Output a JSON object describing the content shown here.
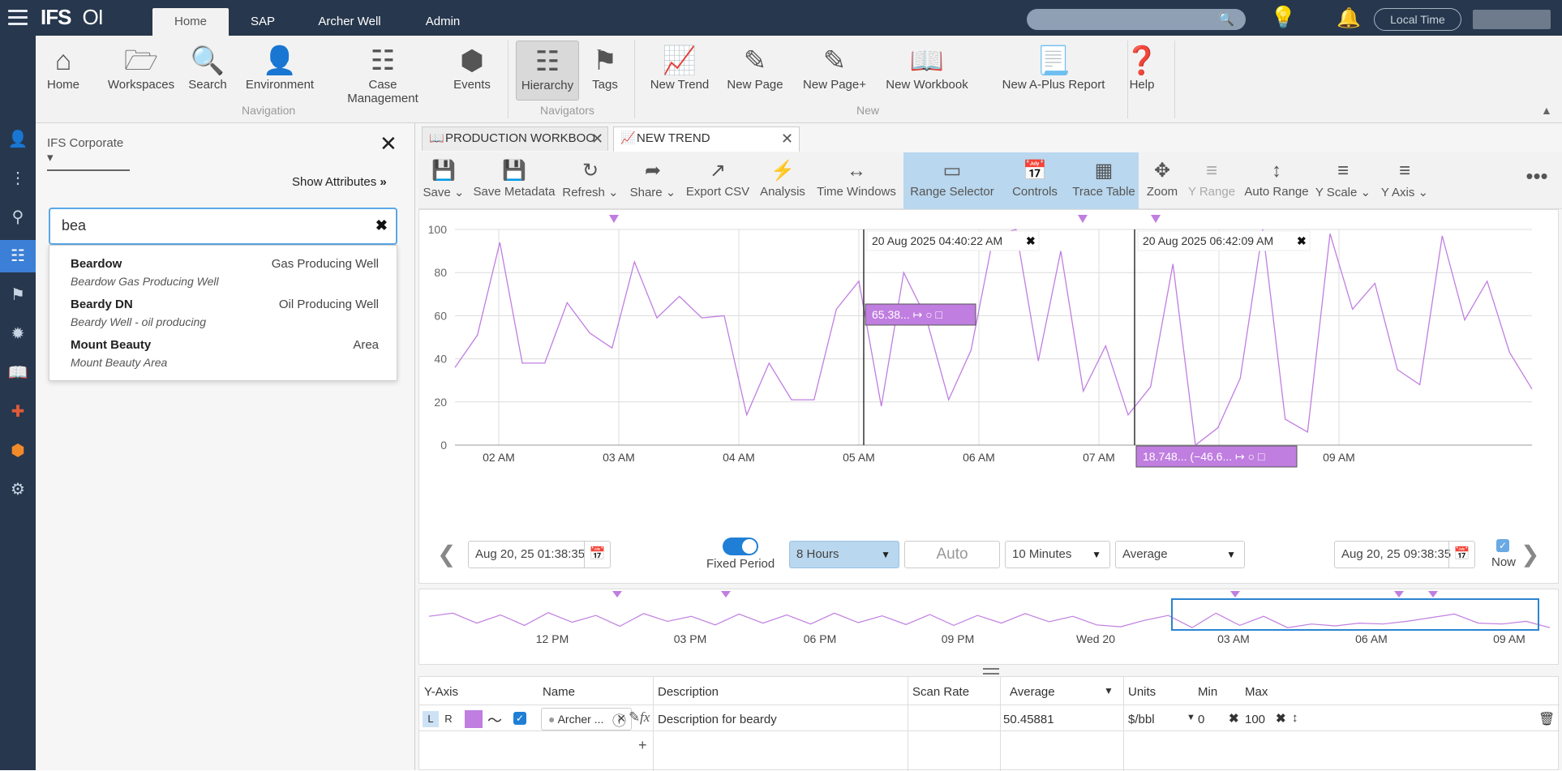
{
  "topbar": {
    "logo": "IFS",
    "product": "OI",
    "tabs": [
      "Home",
      "SAP",
      "Archer Well",
      "Admin"
    ],
    "active_tab": "Home",
    "local_time": "Local Time"
  },
  "ribbon": {
    "navigation": [
      "Home",
      "Workspaces",
      "Search",
      "Environment",
      "Case Management",
      "Events"
    ],
    "navigation_group": "Navigation",
    "navigators": [
      "Hierarchy",
      "Tags"
    ],
    "navigators_group": "Navigators",
    "new_items": [
      "New Trend",
      "New Page",
      "New Page+",
      "New Workbook",
      "New A-Plus Report"
    ],
    "new_group": "New",
    "help": "Help"
  },
  "left_panel": {
    "scope": "IFS Corporate",
    "show_attributes": "Show Attributes",
    "search_value": "bea",
    "results": [
      {
        "name": "Beardow",
        "type": "Gas Producing Well",
        "desc": "Beardow Gas Producing Well"
      },
      {
        "name": "Beardy DN",
        "type": "Oil Producing Well",
        "desc": "Beardy Well - oil producing"
      },
      {
        "name": "Mount Beauty",
        "type": "Area",
        "desc": "Mount Beauty Area"
      }
    ]
  },
  "tabs": [
    "PRODUCTION WORKBOO",
    "NEW TREND"
  ],
  "toolbar": [
    "Save",
    "Save Metadata",
    "Refresh",
    "Share",
    "Export CSV",
    "Analysis",
    "Time Windows",
    "Range Selector",
    "Controls",
    "Trace Table",
    "Zoom",
    "Y Range",
    "Auto Range",
    "Y Scale",
    "Y Axis"
  ],
  "chart_data": {
    "type": "line",
    "y_ticks": [
      0,
      20,
      40,
      60,
      80,
      100
    ],
    "ylim": [
      0,
      100
    ],
    "x_ticks": [
      "02 AM",
      "03 AM",
      "04 AM",
      "05 AM",
      "06 AM",
      "07 AM",
      "08 AM",
      "09 AM"
    ],
    "color": "#c07ee0",
    "series": [
      {
        "values": [
          36,
          51,
          94,
          38,
          38,
          66,
          52,
          45,
          85,
          59,
          69,
          59,
          60,
          14,
          38,
          21,
          21,
          63,
          76,
          18,
          80,
          59,
          21,
          44,
          97,
          100,
          39,
          90,
          25,
          46,
          14,
          27,
          84,
          0,
          8,
          31,
          100,
          12,
          6,
          98,
          63,
          75,
          35,
          28,
          97,
          58,
          76,
          43,
          26
        ]
      }
    ],
    "cursor1": {
      "label": "20 Aug 2025 04:40:22 AM",
      "value": "65.38..."
    },
    "cursor2": {
      "label": "20 Aug 2025 06:42:09 AM",
      "value": "18.748...",
      "delta": "(−46.6..."
    }
  },
  "time_nav": {
    "start": "Aug 20, 25 01:38:35",
    "fixed_period": "Fixed Period",
    "period": "8 Hours",
    "auto": "Auto",
    "interval": "10 Minutes",
    "aggregate": "Average",
    "end": "Aug 20, 25 09:38:35",
    "now": "Now"
  },
  "overview": {
    "x_ticks": [
      "12 PM",
      "03 PM",
      "06 PM",
      "09 PM",
      "Wed 20",
      "03 AM",
      "06 AM",
      "09 AM"
    ],
    "values": [
      55,
      62,
      40,
      58,
      35,
      63,
      42,
      57,
      33,
      61,
      44,
      55,
      36,
      60,
      40,
      58,
      38,
      62,
      41,
      56,
      37,
      59,
      35,
      57,
      40,
      61,
      43,
      55,
      36,
      32,
      46,
      57,
      30,
      62,
      35,
      55,
      30,
      38,
      34,
      40,
      38,
      44,
      52,
      60,
      40,
      38,
      44,
      30
    ]
  },
  "trace_table": {
    "headers": [
      "Y-Axis",
      "Name",
      "Description",
      "Scan Rate",
      "Average",
      "Units",
      "Min",
      "Max"
    ],
    "row": {
      "axis_l": "L",
      "axis_r": "R",
      "name": "Archer ...",
      "description": "Description for beardy",
      "scan_rate": "",
      "average": "50.45881",
      "units": "$/bbl",
      "min": "0",
      "max": "100"
    }
  }
}
